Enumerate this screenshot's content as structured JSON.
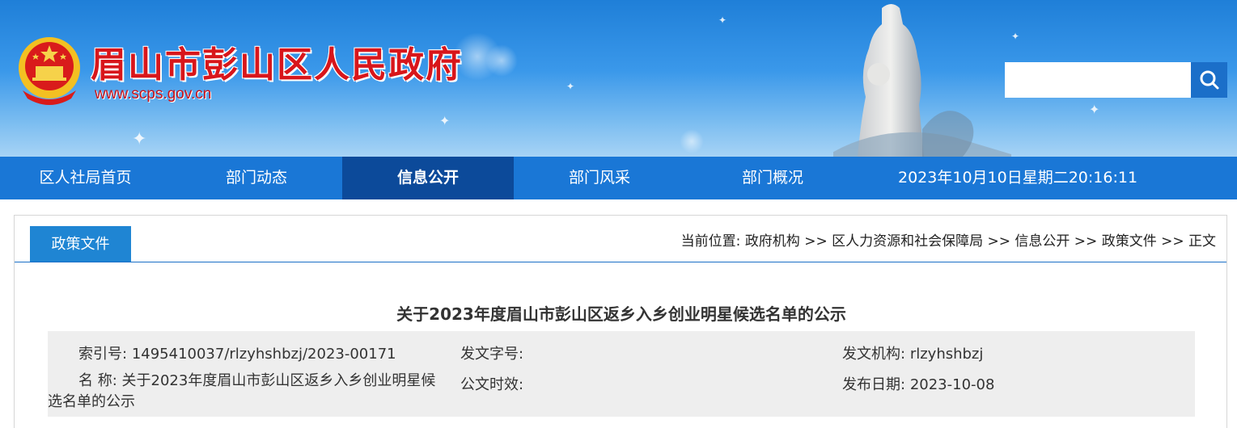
{
  "header": {
    "site_title": "眉山市彭山区人民政府",
    "site_url": "www.scps.gov.cn",
    "search_placeholder": ""
  },
  "nav": {
    "items": [
      {
        "label": "区人社局首页",
        "active": false
      },
      {
        "label": "部门动态",
        "active": false
      },
      {
        "label": "信息公开",
        "active": true
      },
      {
        "label": "部门风采",
        "active": false
      },
      {
        "label": "部门概况",
        "active": false
      }
    ],
    "datetime": "2023年10月10日星期二20:16:11"
  },
  "content": {
    "section_tab": "政策文件",
    "breadcrumb": {
      "prefix": "当前位置: ",
      "links": [
        "政府机构",
        "区人力资源和社会保障局",
        "信息公开",
        "政策文件",
        "正文"
      ],
      "separator": " >> "
    },
    "article_title": "关于2023年度眉山市彭山区返乡入乡创业明星候选名单的公示",
    "meta": {
      "index_label": "索引号:",
      "index_value": "1495410037/rlzyhshbzj/2023-00171",
      "doc_no_label": "发文字号:",
      "doc_no_value": "",
      "agency_label": "发文机构:",
      "agency_value": "rlzyhshbzj",
      "name_label": "名 称:",
      "name_value": "关于2023年度眉山市彭山区返乡入乡创业明星候选名单的公示",
      "validity_label": "公文时效:",
      "validity_value": "",
      "date_label": "发布日期:",
      "date_value": "2023-10-08"
    }
  },
  "colors": {
    "nav_bg": "#1a77d6",
    "nav_active": "#0c4a9a",
    "title_red": "#d8161b",
    "tab_blue": "#1f85d3"
  }
}
